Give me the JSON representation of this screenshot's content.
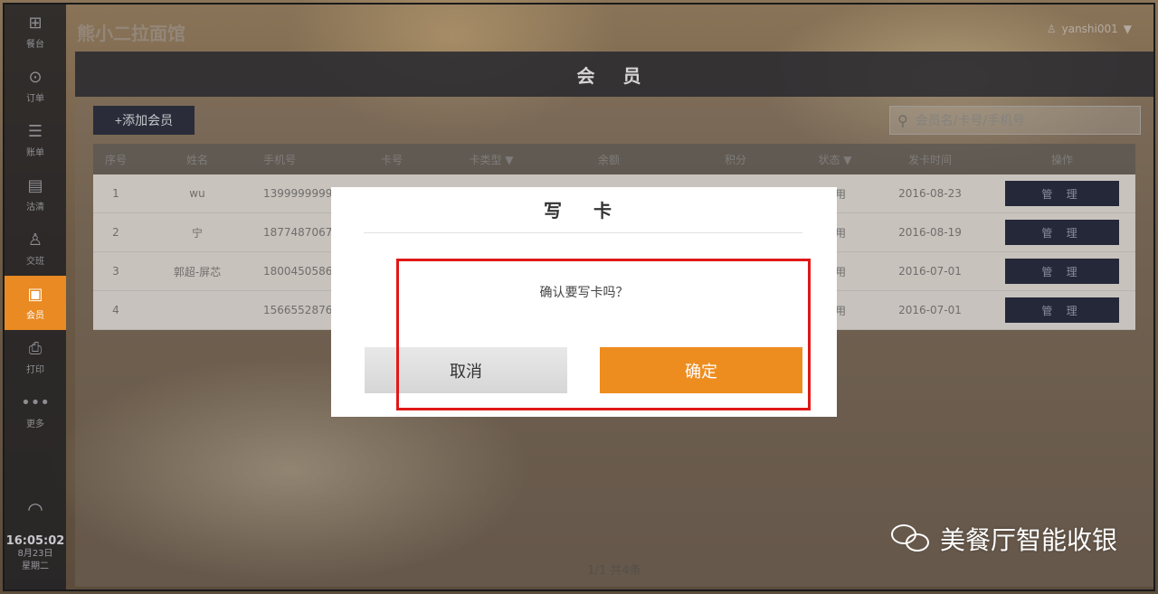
{
  "app": {
    "shop_name": "熊小二拉面馆",
    "user": "yanshi001"
  },
  "sidebar": {
    "items": [
      {
        "label": "餐台",
        "icon": "plus-box-icon"
      },
      {
        "label": "订单",
        "icon": "chat-dots-icon"
      },
      {
        "label": "账单",
        "icon": "list-doc-icon"
      },
      {
        "label": "沽清",
        "icon": "document-icon"
      },
      {
        "label": "交班",
        "icon": "user-icon"
      },
      {
        "label": "会员",
        "icon": "member-card-icon",
        "active": true
      },
      {
        "label": "打印",
        "icon": "printer-icon"
      },
      {
        "label": "更多",
        "icon": "more-dots-icon"
      }
    ],
    "time": "16:05:02",
    "date": "8月23日",
    "weekday": "星期二"
  },
  "page": {
    "title": "会 员",
    "add_button": "+添加会员",
    "search_placeholder": "会员名/卡号/手机号"
  },
  "table": {
    "headers": [
      "序号",
      "姓名",
      "手机号",
      "卡号",
      "卡类型",
      "余额",
      "积分",
      "状态",
      "发卡时间",
      "操作"
    ],
    "rows": [
      {
        "no": "1",
        "name": "wu",
        "phone": "1399999999",
        "status": "启用",
        "issued": "2016-08-23",
        "action": "管 理"
      },
      {
        "no": "2",
        "name": "宁",
        "phone": "1877487067",
        "status": "启用",
        "issued": "2016-08-19",
        "action": "管 理"
      },
      {
        "no": "3",
        "name": "郭超-屏芯",
        "phone": "1800450586",
        "status": "启用",
        "issued": "2016-07-01",
        "action": "管 理"
      },
      {
        "no": "4",
        "name": "",
        "phone": "1566552876",
        "status": "启用",
        "issued": "2016-07-01",
        "action": "管 理"
      }
    ],
    "pager": "1/1   共4条"
  },
  "dialog": {
    "title": "写 卡",
    "message": "确认要写卡吗？",
    "cancel": "取消",
    "confirm": "确定"
  },
  "watermark": "美餐厅智能收银",
  "colors": {
    "accent": "#ee8d1f",
    "highlight": "#e01818",
    "dark_button": "#252838"
  }
}
